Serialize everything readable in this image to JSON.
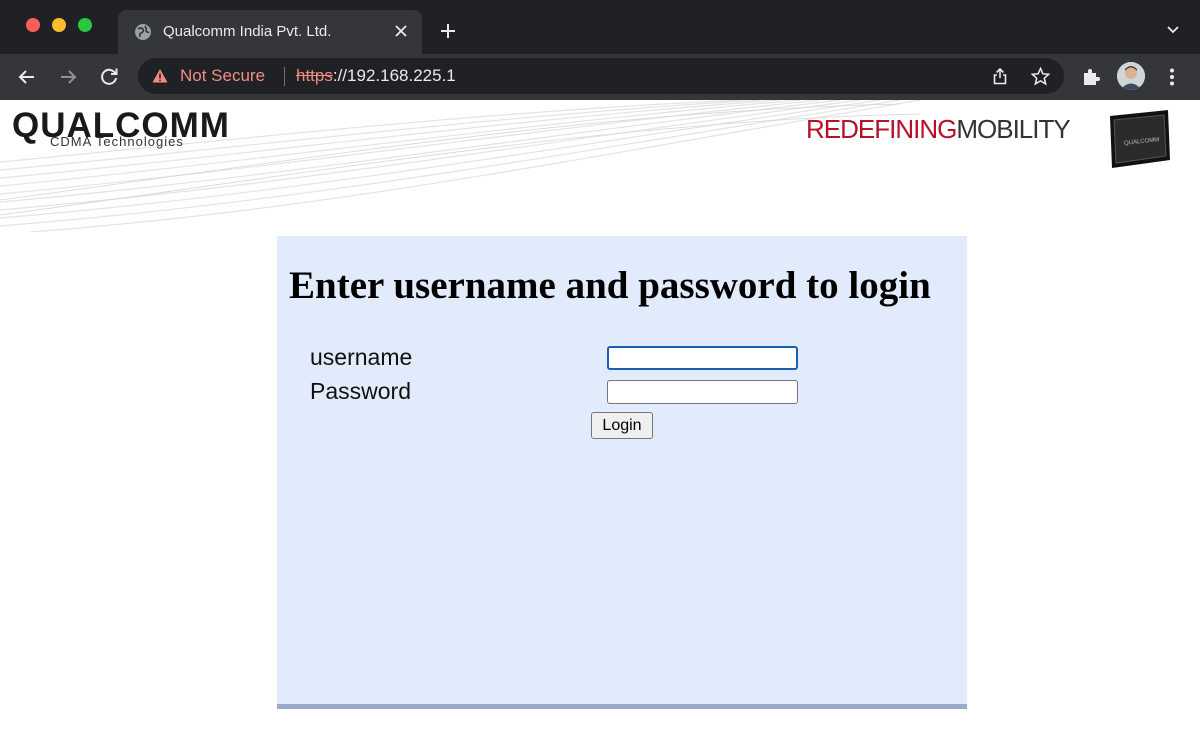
{
  "browser": {
    "tab_title": "Qualcomm India Pvt. Ltd.",
    "security_label": "Not Secure",
    "url_scheme": "https",
    "url_rest": "://192.168.225.1"
  },
  "banner": {
    "logo_text": "QUALCOMM",
    "logo_subtext": "CDMA Technologies",
    "tagline_part1": "REDEFINING",
    "tagline_part2": "MOBILITY"
  },
  "login": {
    "heading": "Enter username and password to login",
    "username_label": "username",
    "password_label": "Password",
    "username_value": "",
    "password_value": "",
    "login_button": "Login"
  },
  "colors": {
    "panel_background": "#e1ebfb",
    "not_secure": "#f28b82",
    "tagline_red": "#b5122a"
  },
  "icons": [
    "back-icon",
    "forward-icon",
    "reload-icon",
    "warning-icon",
    "share-icon",
    "star-icon",
    "extensions-icon",
    "profile-avatar",
    "menu-icon",
    "globe-icon",
    "close-icon",
    "plus-icon",
    "chevron-down-icon"
  ]
}
